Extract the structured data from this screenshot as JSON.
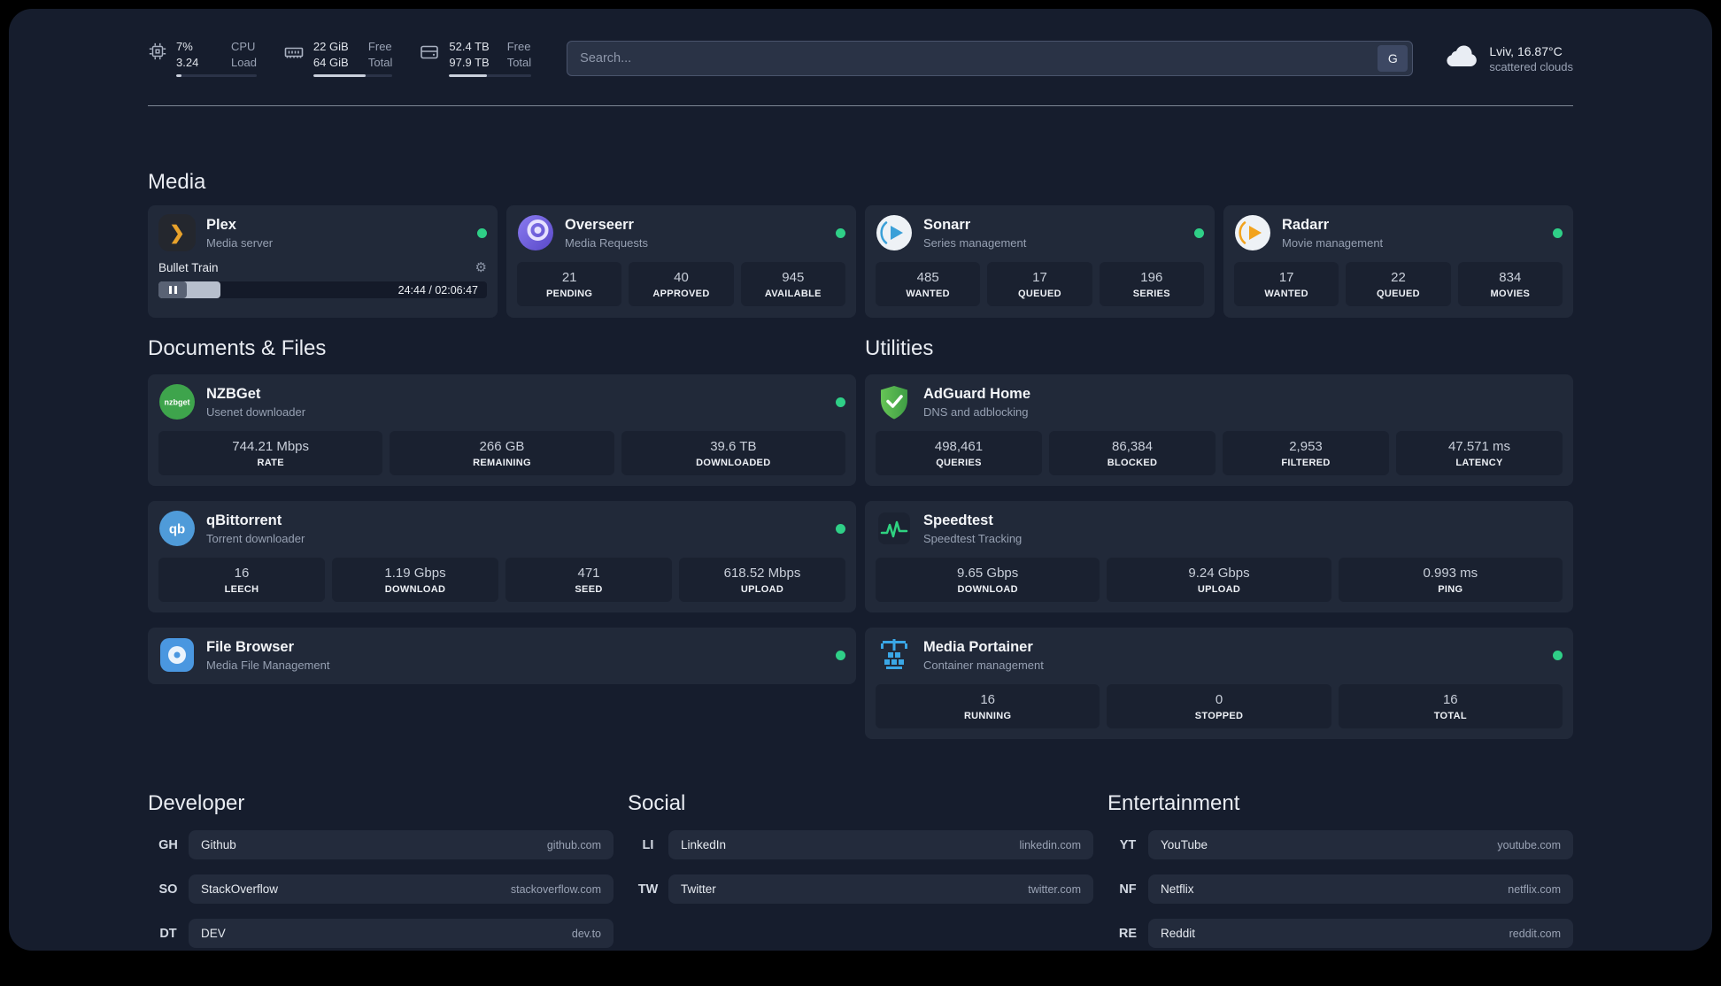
{
  "topbar": {
    "resources": [
      {
        "val1": "7%",
        "val2": "3.24",
        "lab1": "CPU",
        "lab2": "Load",
        "progress": 7
      },
      {
        "val1": "22 GiB",
        "val2": "64 GiB",
        "lab1": "Free",
        "lab2": "Total",
        "progress": 66
      },
      {
        "val1": "52.4 TB",
        "val2": "97.9 TB",
        "lab1": "Free",
        "lab2": "Total",
        "progress": 46
      }
    ],
    "search": {
      "placeholder": "Search...",
      "provider_label": "G"
    },
    "weather": {
      "location": "Lviv, 16.87°C",
      "condition": "scattered clouds"
    }
  },
  "icons": {
    "gear": "⚙"
  },
  "colors": {
    "accent_green": "#2fcf87",
    "background": "#161d2d",
    "card": "#212939"
  },
  "sections": {
    "media": {
      "title": "Media",
      "plex": {
        "name": "Plex",
        "desc": "Media server",
        "now_playing": "Bullet Train",
        "time": "24:44 / 02:06:47",
        "progress": 19
      },
      "overseerr": {
        "name": "Overseerr",
        "desc": "Media Requests",
        "stats": [
          {
            "value": "21",
            "label": "PENDING"
          },
          {
            "value": "40",
            "label": "APPROVED"
          },
          {
            "value": "945",
            "label": "AVAILABLE"
          }
        ]
      },
      "sonarr": {
        "name": "Sonarr",
        "desc": "Series management",
        "stats": [
          {
            "value": "485",
            "label": "WANTED"
          },
          {
            "value": "17",
            "label": "QUEUED"
          },
          {
            "value": "196",
            "label": "SERIES"
          }
        ]
      },
      "radarr": {
        "name": "Radarr",
        "desc": "Movie management",
        "stats": [
          {
            "value": "17",
            "label": "WANTED"
          },
          {
            "value": "22",
            "label": "QUEUED"
          },
          {
            "value": "834",
            "label": "MOVIES"
          }
        ]
      }
    },
    "documents": {
      "title": "Documents & Files",
      "nzbget": {
        "name": "NZBGet",
        "desc": "Usenet downloader",
        "icon_text": "nzbget",
        "stats": [
          {
            "value": "744.21 Mbps",
            "label": "RATE"
          },
          {
            "value": "266 GB",
            "label": "REMAINING"
          },
          {
            "value": "39.6 TB",
            "label": "DOWNLOADED"
          }
        ]
      },
      "qbittorrent": {
        "name": "qBittorrent",
        "desc": "Torrent downloader",
        "icon_text": "qb",
        "stats": [
          {
            "value": "16",
            "label": "LEECH"
          },
          {
            "value": "1.19 Gbps",
            "label": "DOWNLOAD"
          },
          {
            "value": "471",
            "label": "SEED"
          },
          {
            "value": "618.52 Mbps",
            "label": "UPLOAD"
          }
        ]
      },
      "filebrowser": {
        "name": "File Browser",
        "desc": "Media File Management"
      }
    },
    "utilities": {
      "title": "Utilities",
      "adguard": {
        "name": "AdGuard Home",
        "desc": "DNS and adblocking",
        "stats": [
          {
            "value": "498,461",
            "label": "QUERIES"
          },
          {
            "value": "86,384",
            "label": "BLOCKED"
          },
          {
            "value": "2,953",
            "label": "FILTERED"
          },
          {
            "value": "47.571 ms",
            "label": "LATENCY"
          }
        ]
      },
      "speedtest": {
        "name": "Speedtest",
        "desc": "Speedtest Tracking",
        "stats": [
          {
            "value": "9.65 Gbps",
            "label": "DOWNLOAD"
          },
          {
            "value": "9.24 Gbps",
            "label": "UPLOAD"
          },
          {
            "value": "0.993 ms",
            "label": "PING"
          }
        ]
      },
      "portainer": {
        "name": "Media Portainer",
        "desc": "Container management",
        "stats": [
          {
            "value": "16",
            "label": "RUNNING"
          },
          {
            "value": "0",
            "label": "STOPPED"
          },
          {
            "value": "16",
            "label": "TOTAL"
          }
        ]
      }
    }
  },
  "bookmarks": {
    "groups": [
      {
        "title": "Developer",
        "items": [
          {
            "abbr": "GH",
            "name": "Github",
            "url": "github.com"
          },
          {
            "abbr": "SO",
            "name": "StackOverflow",
            "url": "stackoverflow.com"
          },
          {
            "abbr": "DT",
            "name": "DEV",
            "url": "dev.to"
          }
        ]
      },
      {
        "title": "Social",
        "items": [
          {
            "abbr": "LI",
            "name": "LinkedIn",
            "url": "linkedin.com"
          },
          {
            "abbr": "TW",
            "name": "Twitter",
            "url": "twitter.com"
          }
        ]
      },
      {
        "title": "Entertainment",
        "items": [
          {
            "abbr": "YT",
            "name": "YouTube",
            "url": "youtube.com"
          },
          {
            "abbr": "NF",
            "name": "Netflix",
            "url": "netflix.com"
          },
          {
            "abbr": "RE",
            "name": "Reddit",
            "url": "reddit.com"
          }
        ]
      }
    ]
  }
}
